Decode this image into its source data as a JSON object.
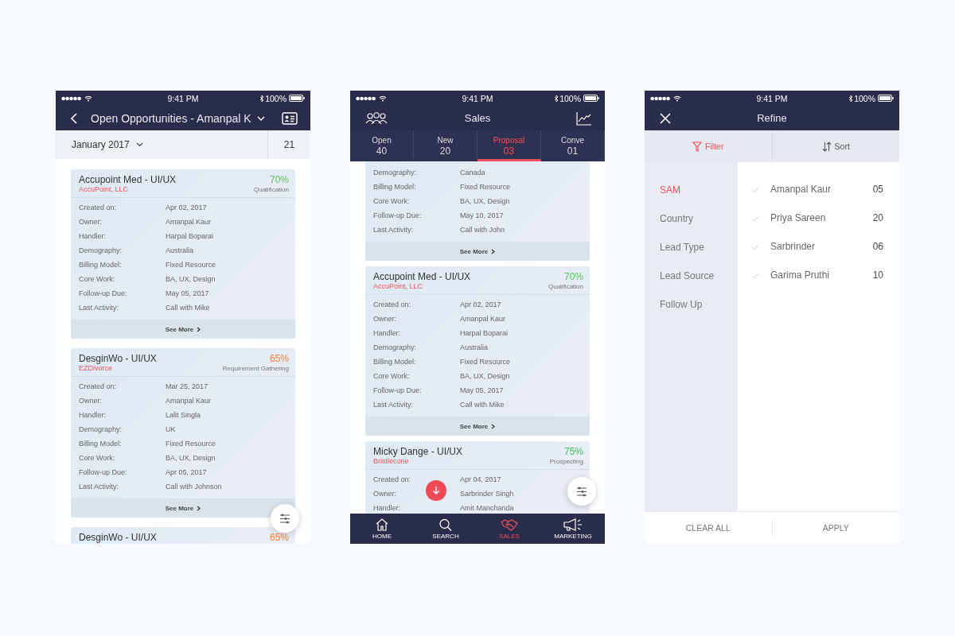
{
  "opportunities_screen": {
    "status_bar": {
      "time": "9:41 PM",
      "battery": "100%"
    },
    "title": "Open Opportunities - Amanpal K",
    "month": "January 2017",
    "count": "21",
    "cards": [
      {
        "title": "Accupoint Med - UI/UX",
        "company": "AccuPoint, LLC",
        "percent": "70%",
        "color": "#5cc45a",
        "stage": "Qualification",
        "fields": [
          {
            "label": "Created on:",
            "value": "Apr 02, 2017"
          },
          {
            "label": "Owner:",
            "value": "Amanpal Kaur"
          },
          {
            "label": "Handler:",
            "value": "Harpal Boparai"
          },
          {
            "label": "Demography:",
            "value": "Australia"
          },
          {
            "label": "Billing Model:",
            "value": "Fixed Resource"
          },
          {
            "label": "Core Work:",
            "value": "BA, UX, Design"
          },
          {
            "label": "Follow-up Due:",
            "value": "May 05, 2017"
          },
          {
            "label": "Last Activity:",
            "value": "Call with Mike"
          }
        ],
        "see_more": "See More"
      },
      {
        "title": "DesginWo - UI/UX",
        "company": "EZDivorce",
        "percent": "65%",
        "color": "#f5833a",
        "stage": "Requirement Gathering",
        "fields": [
          {
            "label": "Created on:",
            "value": "Mar 25, 2017"
          },
          {
            "label": "Owner:",
            "value": "Amanpal Kaur"
          },
          {
            "label": "Handler:",
            "value": "Lalit Singla"
          },
          {
            "label": "Demography:",
            "value": "UK"
          },
          {
            "label": "Billing Model:",
            "value": "Fixed Resource"
          },
          {
            "label": "Core Work:",
            "value": "BA, UX, Design"
          },
          {
            "label": "Follow-up Due:",
            "value": "Apr 05, 2017"
          },
          {
            "label": "Last Activity:",
            "value": "Call with Johnson"
          }
        ],
        "see_more": "See More"
      },
      {
        "title": "DesginWo - UI/UX",
        "percent": "65%",
        "color": "#f5833a"
      }
    ]
  },
  "sales_screen": {
    "status_bar": {
      "time": "9:41 PM",
      "battery": "100%"
    },
    "title": "Sales",
    "tabs": [
      {
        "label": "Open",
        "count": "40",
        "selected": false
      },
      {
        "label": "New",
        "count": "20",
        "selected": false
      },
      {
        "label": "Proposal",
        "count": "03",
        "selected": true
      },
      {
        "label": "Conve",
        "count": "01",
        "selected": false
      }
    ],
    "cards": [
      {
        "fields": [
          {
            "label": "Demography:",
            "value": "Canada"
          },
          {
            "label": "Billing Model:",
            "value": "Fixed Resource"
          },
          {
            "label": "Core Work:",
            "value": "BA, UX, Design"
          },
          {
            "label": "Follow-up Due:",
            "value": "May 10, 2017"
          },
          {
            "label": "Last Activity:",
            "value": "Call with John"
          }
        ],
        "see_more": "See More"
      },
      {
        "title": "Accupoint Med - UI/UX",
        "company": "AccuPoint, LLC",
        "percent": "70%",
        "color": "#5cc45a",
        "stage": "Qualification",
        "fields": [
          {
            "label": "Created on:",
            "value": "Apr 02, 2017"
          },
          {
            "label": "Owner:",
            "value": "Amanpal Kaur"
          },
          {
            "label": "Handler:",
            "value": "Harpal Boparai"
          },
          {
            "label": "Demography:",
            "value": "Australia"
          },
          {
            "label": "Billing Model:",
            "value": "Fixed Resource"
          },
          {
            "label": "Core Work:",
            "value": "BA, UX, Design"
          },
          {
            "label": "Follow-up Due:",
            "value": "May 05, 2017"
          },
          {
            "label": "Last Activity:",
            "value": "Call with Mike"
          }
        ],
        "see_more": "See More"
      },
      {
        "title": "Micky Dange - UI/UX",
        "company": "Bristlecone",
        "percent": "75%",
        "color": "#3cbf5a",
        "stage": "Prospecting",
        "fields": [
          {
            "label": "Created on:",
            "value": "Apr 04, 2017"
          },
          {
            "label": "Owner:",
            "value": "Sarbrinder Singh"
          },
          {
            "label": "Handler:",
            "value": "Amit Manchanda"
          }
        ]
      }
    ],
    "nav": [
      {
        "label": "HOME",
        "selected": false
      },
      {
        "label": "SEARCH",
        "selected": false
      },
      {
        "label": "SALES",
        "selected": true
      },
      {
        "label": "MARKETING",
        "selected": false
      }
    ]
  },
  "refine_screen": {
    "status_bar": {
      "time": "9:41 PM",
      "battery": "100%"
    },
    "title": "Refine",
    "tabs": [
      {
        "label": "Filter",
        "selected": true
      },
      {
        "label": "Sort",
        "selected": false
      }
    ],
    "categories": [
      {
        "label": "SAM",
        "selected": true
      },
      {
        "label": "Country",
        "selected": false
      },
      {
        "label": "Lead Type",
        "selected": false
      },
      {
        "label": "Lead Source",
        "selected": false
      },
      {
        "label": "Follow Up",
        "selected": false
      }
    ],
    "options": [
      {
        "name": "Amanpal Kaur",
        "count": "05",
        "checked": false
      },
      {
        "name": "Priya Sareen",
        "count": "20",
        "checked": false
      },
      {
        "name": "Sarbrinder",
        "count": "06",
        "checked": false
      },
      {
        "name": "Garima Pruthi",
        "count": "10",
        "checked": false
      }
    ],
    "buttons": [
      "CLEAR ALL",
      "APPLY"
    ]
  }
}
